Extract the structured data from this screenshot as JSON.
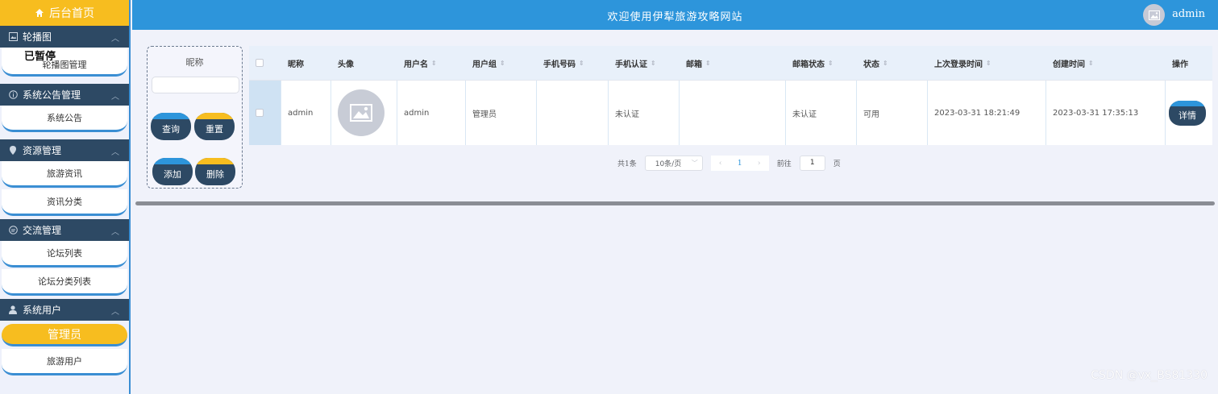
{
  "sidebar": {
    "home_label": "后台首页",
    "paused_overlay": "已暂停",
    "groups": [
      {
        "title": "轮播图",
        "items": [
          "轮播图管理"
        ]
      },
      {
        "title": "系统公告管理",
        "items": [
          "系统公告"
        ]
      },
      {
        "title": "资源管理",
        "items": [
          "旅游资讯",
          "资讯分类"
        ]
      },
      {
        "title": "交流管理",
        "items": [
          "论坛列表",
          "论坛分类列表"
        ]
      },
      {
        "title": "系统用户",
        "items": [
          "管理员",
          "旅游用户"
        ]
      }
    ],
    "active_item": "管理员"
  },
  "header": {
    "title": "欢迎使用伊犁旅游攻略网站",
    "username": "admin"
  },
  "search": {
    "label": "昵称",
    "input_value": "",
    "query_button": "查询",
    "reset_button": "重置",
    "add_button": "添加",
    "delete_button": "删除"
  },
  "table": {
    "columns": [
      "昵称",
      "头像",
      "用户名",
      "用户组",
      "手机号码",
      "手机认证",
      "邮箱",
      "邮箱状态",
      "状态",
      "上次登录时间",
      "创建时间",
      "操作"
    ],
    "rows": [
      {
        "nickname": "admin",
        "avatar": "image-placeholder-icon",
        "username": "admin",
        "group": "管理员",
        "phone": "",
        "phone_verified": "未认证",
        "email": "",
        "email_status": "未认证",
        "status": "可用",
        "last_login": "2023-03-31 18:21:49",
        "created": "2023-03-31 17:35:13",
        "action": "详情"
      }
    ]
  },
  "pagination": {
    "total": "共1条",
    "page_size": "10条/页",
    "current_page": "1",
    "goto_prefix": "前往",
    "goto_value": "1",
    "goto_suffix": "页"
  },
  "watermark": "CSDN @vx_BS81330",
  "colors": {
    "primary": "#2d95db",
    "accent": "#f7bd1f",
    "dark": "#2d4964"
  }
}
